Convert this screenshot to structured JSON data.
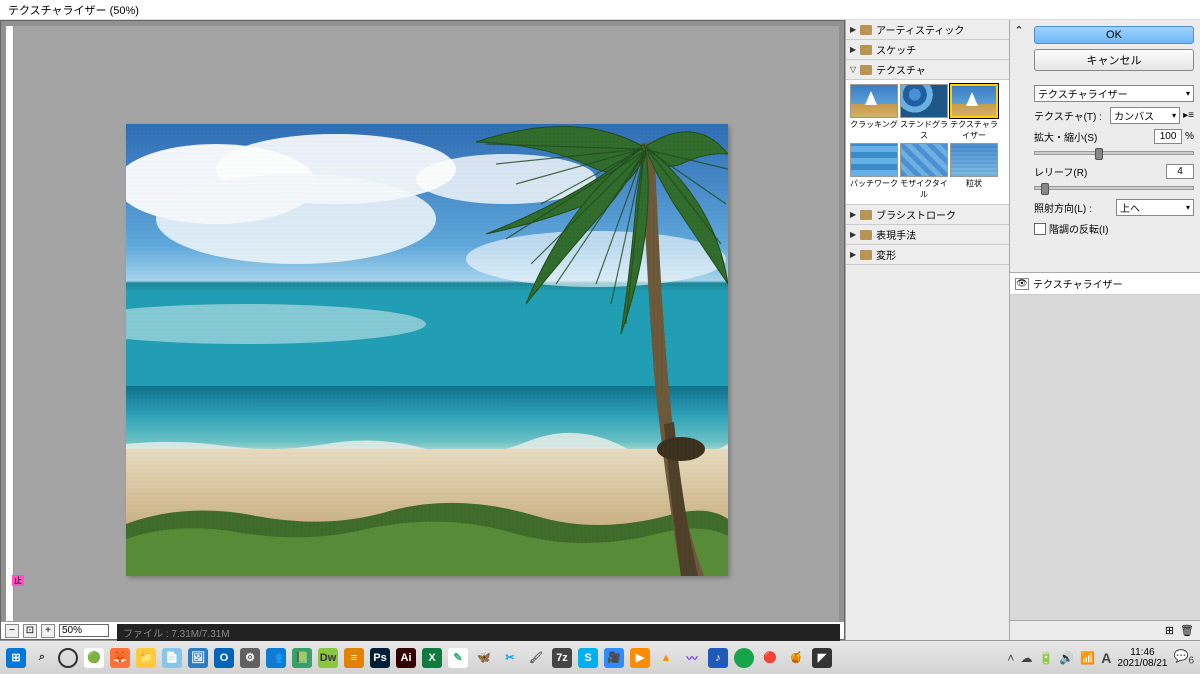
{
  "titlebar": "テクスチャライザー (50%)",
  "zoom": {
    "minus": "−",
    "plus": "+",
    "value": "50%",
    "fit": "⊡"
  },
  "marker": "止",
  "filter_categories": {
    "artistic": "アーティスティック",
    "sketch": "スケッチ",
    "texture": "テクスチャ",
    "brushstroke": "ブラシストローク",
    "stylize": "表現手法",
    "distort": "変形"
  },
  "filters": {
    "crackling": "クラッキング",
    "stained_glass": "ステンドグラス",
    "texturizer": "テクスチャライザー",
    "patchwork": "パッチワーク",
    "mosaic_tile": "モザイクタイル",
    "grain": "粒状"
  },
  "settings": {
    "ok": "OK",
    "cancel": "キャンセル",
    "filter_name": "テクスチャライザー",
    "texture_label": "テクスチャ(T) :",
    "texture_value": "カンバス",
    "scale_label": "拡大・縮小(S)",
    "scale_value": "100",
    "scale_unit": "%",
    "relief_label": "レリーフ(R)",
    "relief_value": "4",
    "light_label": "照射方向(L) :",
    "light_value": "上へ",
    "invert_label": "階調の反転(I)"
  },
  "layers": {
    "name": "テクスチャライザー",
    "new": "⊞",
    "delete": "🗑"
  },
  "collapse": "⌃",
  "status_text": "ファイル : 7.31M/7.31M",
  "taskbar": {
    "time": "11:46",
    "date": "2021/08/21",
    "notif": "6",
    "ime": "A"
  }
}
